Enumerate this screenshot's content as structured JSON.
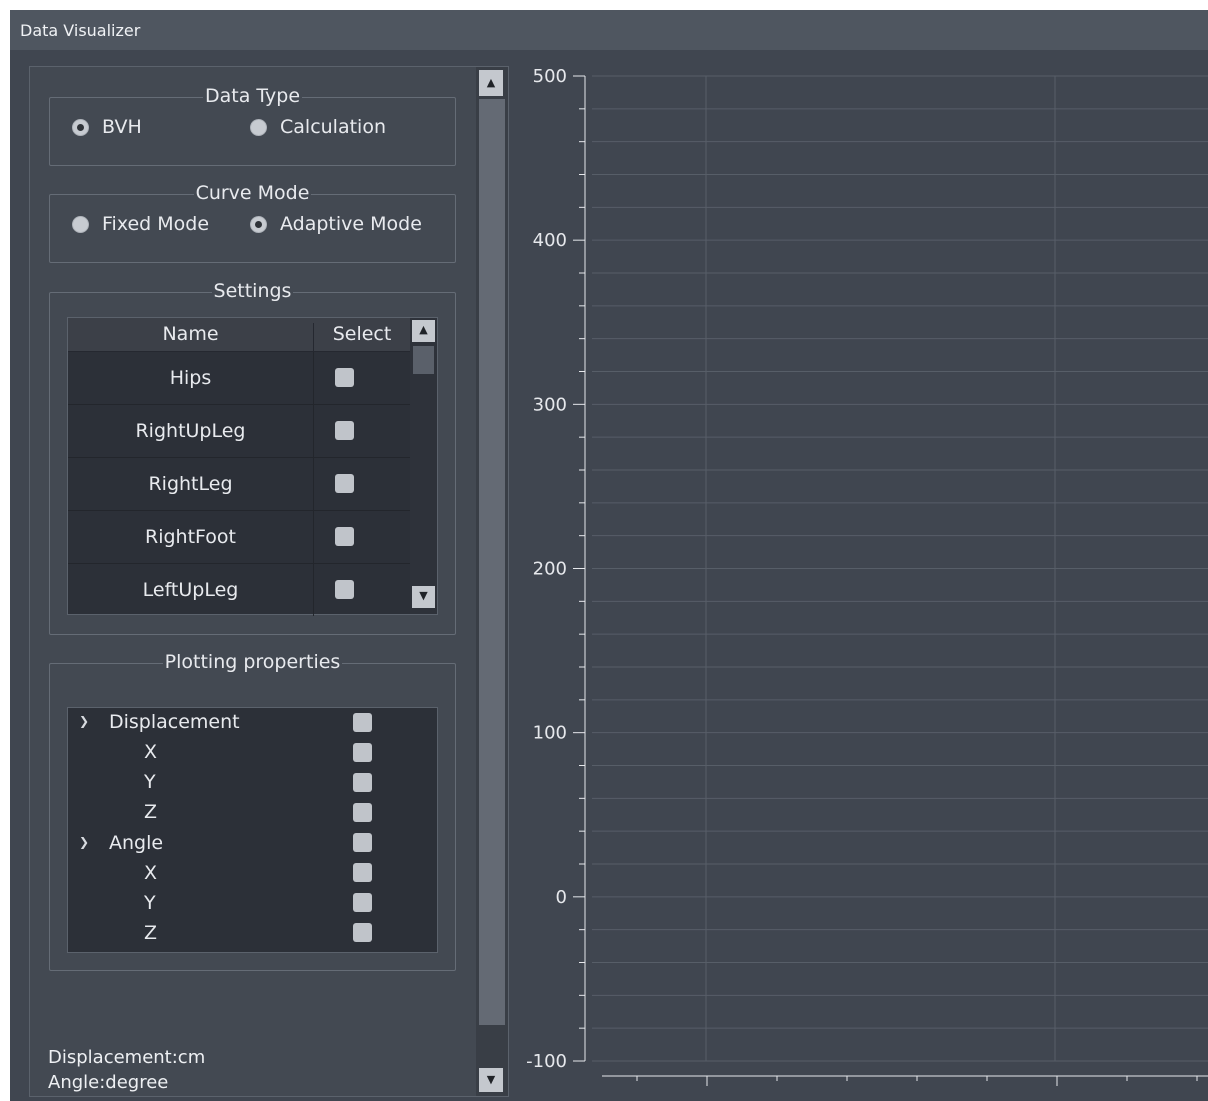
{
  "window": {
    "title": "Data Visualizer"
  },
  "data_type": {
    "title": "Data Type",
    "options": [
      {
        "label": "BVH",
        "checked": true
      },
      {
        "label": "Calculation",
        "checked": false
      }
    ]
  },
  "curve_mode": {
    "title": "Curve Mode",
    "options": [
      {
        "label": "Fixed Mode",
        "checked": false
      },
      {
        "label": "Adaptive Mode",
        "checked": true
      }
    ]
  },
  "settings": {
    "title": "Settings",
    "columns": [
      "Name",
      "Select"
    ],
    "rows": [
      {
        "name": "Hips",
        "selected": false
      },
      {
        "name": "RightUpLeg",
        "selected": false
      },
      {
        "name": "RightLeg",
        "selected": false
      },
      {
        "name": "RightFoot",
        "selected": false
      },
      {
        "name": "LeftUpLeg",
        "selected": false
      }
    ]
  },
  "plotting_properties": {
    "title": "Plotting properties",
    "groups": [
      {
        "label": "Displacement",
        "children": [
          "X",
          "Y",
          "Z"
        ]
      },
      {
        "label": "Angle",
        "children": [
          "X",
          "Y",
          "Z"
        ]
      }
    ]
  },
  "units": {
    "displacement": "Displacement:cm",
    "angle": "Angle:degree"
  },
  "chart_data": {
    "type": "line",
    "series": [],
    "ylim": [
      -100,
      500
    ],
    "yticks": [
      "500",
      "400",
      "300",
      "200",
      "100",
      "0",
      "-100"
    ],
    "grid": true,
    "colors": {
      "background": "#404650",
      "grid": "#575e68",
      "axis": "#e6e8ec"
    }
  }
}
